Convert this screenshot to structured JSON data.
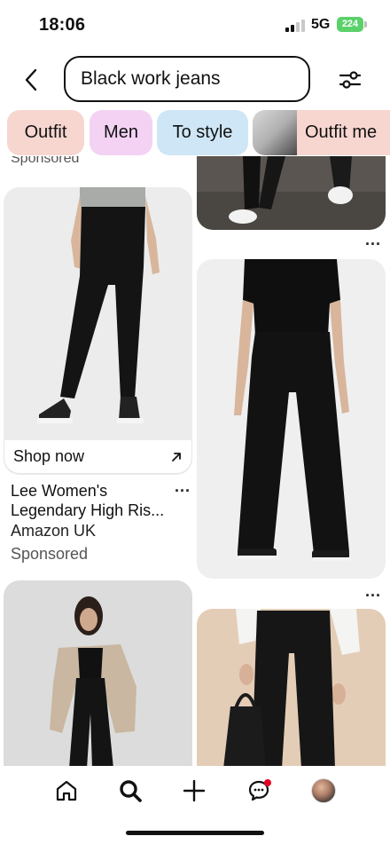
{
  "status_bar": {
    "time": "18:06",
    "network": "5G",
    "battery": "224"
  },
  "header": {
    "search_value": "Black work jeans",
    "back_icon": "chevron-left-icon",
    "filter_icon": "sliders-icon"
  },
  "chips": [
    {
      "label": "Outfit",
      "color": "#f7d6d0"
    },
    {
      "label": "Men",
      "color": "#f4d2f4"
    },
    {
      "label": "To style",
      "color": "#cfe6f6"
    },
    {
      "label": "Outfit me",
      "color": "#f7d6d0"
    }
  ],
  "feed": {
    "top_left_sponsored": "Sponsored",
    "shop_pin": {
      "cta": "Shop now",
      "title": "Lee Women's Legendary High Ris...",
      "merchant": "Amazon UK",
      "sponsored": "Sponsored"
    },
    "more_label": "..."
  },
  "bottom_nav": {
    "items": [
      "home-icon",
      "search-icon",
      "create-icon",
      "messages-icon",
      "profile-avatar"
    ],
    "has_notification": true
  },
  "colors": {
    "accent_red": "#e60023",
    "battery_green": "#5bd16b"
  }
}
